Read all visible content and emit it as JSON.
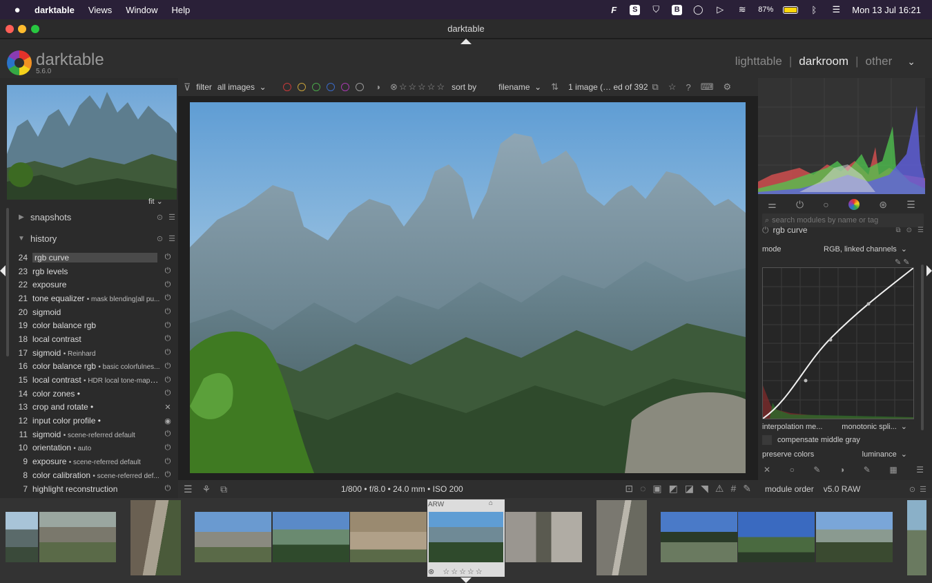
{
  "menubar": {
    "app": "darktable",
    "items": [
      "Views",
      "Window",
      "Help"
    ],
    "battery_percent": "87%",
    "datetime": "Mon 13 Jul  16:21"
  },
  "window": {
    "title": "darktable"
  },
  "header": {
    "app_name": "darktable",
    "version": "5.6.0",
    "views": [
      "lighttable",
      "darkroom",
      "other"
    ],
    "active_view": "darkroom"
  },
  "navigation": {
    "zoom": "fit"
  },
  "panels": {
    "snapshots": "snapshots",
    "history": "history"
  },
  "history": [
    {
      "num": "24",
      "name": "rgb curve",
      "sub": "",
      "state": "on"
    },
    {
      "num": "23",
      "name": "rgb levels",
      "sub": "",
      "state": "on"
    },
    {
      "num": "22",
      "name": "exposure",
      "sub": "",
      "state": "on"
    },
    {
      "num": "21",
      "name": "tone equalizer",
      "sub": "• mask blending|all pu...",
      "state": "on"
    },
    {
      "num": "20",
      "name": "sigmoid",
      "sub": "",
      "state": "on"
    },
    {
      "num": "19",
      "name": "color balance rgb",
      "sub": "",
      "state": "on"
    },
    {
      "num": "18",
      "name": "local contrast",
      "sub": "",
      "state": "on"
    },
    {
      "num": "17",
      "name": "sigmoid",
      "sub": "• Reinhard",
      "state": "on"
    },
    {
      "num": "16",
      "name": "color balance rgb",
      "sub": "• basic colorfulnes...",
      "state": "on"
    },
    {
      "num": "15",
      "name": "local contrast",
      "sub": "• HDR local tone-mapping",
      "state": "on"
    },
    {
      "num": "14",
      "name": "color zones •",
      "sub": "",
      "state": "on"
    },
    {
      "num": "13",
      "name": "crop and rotate •",
      "sub": "",
      "state": "off"
    },
    {
      "num": "12",
      "name": "input color profile •",
      "sub": "",
      "state": "always"
    },
    {
      "num": "11",
      "name": "sigmoid",
      "sub": "• scene-referred default",
      "state": "on"
    },
    {
      "num": "10",
      "name": "orientation",
      "sub": "• auto",
      "state": "on"
    },
    {
      "num": "9",
      "name": "exposure",
      "sub": "• scene-referred default",
      "state": "on"
    },
    {
      "num": "8",
      "name": "color calibration",
      "sub": "• scene-referred def...",
      "state": "on"
    },
    {
      "num": "7",
      "name": "highlight reconstruction",
      "sub": "",
      "state": "on"
    }
  ],
  "toolbar": {
    "filter_label": "filter",
    "filter_value": "all images",
    "sort_label": "sort by",
    "sort_value": "filename",
    "count": "1 image (… ed of 392",
    "color_labels": [
      "#c83a3a",
      "#c8a23a",
      "#4aa84a",
      "#3a6ac8",
      "#a83ab0",
      "#9a9a9a"
    ],
    "rating": "☆☆☆☆☆"
  },
  "exif": "1/800 • f/8.0 • 24.0 mm • ISO 200",
  "right_panel": {
    "search_placeholder": "search modules by name or tag",
    "module_title": "rgb curve",
    "mode_label": "mode",
    "mode_value": "RGB, linked channels",
    "interp_label": "interpolation me...",
    "interp_value": "monotonic spli...",
    "compensate_label": "compensate middle gray",
    "preserve_label": "preserve colors",
    "preserve_value": "luminance",
    "module_order_label": "module order",
    "module_order_value": "v5.0 RAW"
  },
  "filmstrip": {
    "selected_label": "ARW",
    "selected_rating": "☆☆☆☆☆"
  }
}
